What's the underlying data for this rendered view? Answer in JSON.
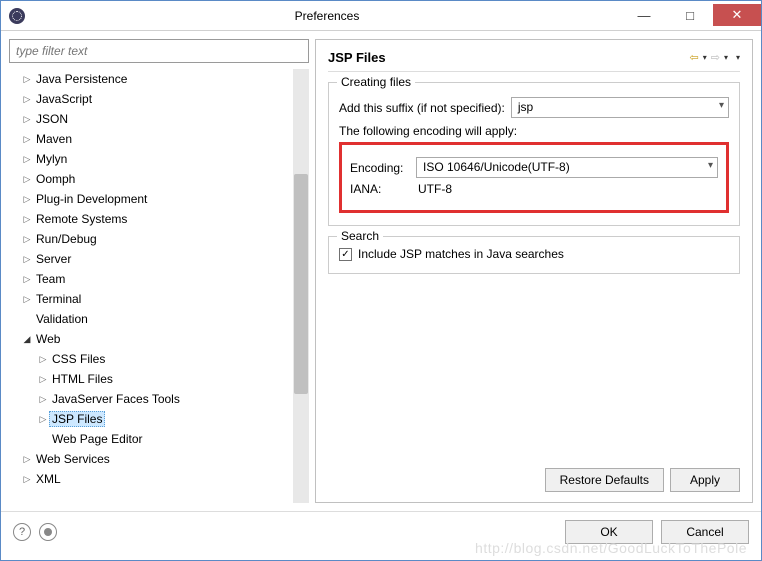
{
  "window": {
    "title": "Preferences"
  },
  "filter": {
    "placeholder": "type filter text"
  },
  "tree": {
    "items": [
      {
        "label": "Java Persistence",
        "level": 1,
        "expand": "▷"
      },
      {
        "label": "JavaScript",
        "level": 1,
        "expand": "▷"
      },
      {
        "label": "JSON",
        "level": 1,
        "expand": "▷"
      },
      {
        "label": "Maven",
        "level": 1,
        "expand": "▷"
      },
      {
        "label": "Mylyn",
        "level": 1,
        "expand": "▷"
      },
      {
        "label": "Oomph",
        "level": 1,
        "expand": "▷"
      },
      {
        "label": "Plug-in Development",
        "level": 1,
        "expand": "▷"
      },
      {
        "label": "Remote Systems",
        "level": 1,
        "expand": "▷"
      },
      {
        "label": "Run/Debug",
        "level": 1,
        "expand": "▷"
      },
      {
        "label": "Server",
        "level": 1,
        "expand": "▷"
      },
      {
        "label": "Team",
        "level": 1,
        "expand": "▷"
      },
      {
        "label": "Terminal",
        "level": 1,
        "expand": "▷"
      },
      {
        "label": "Validation",
        "level": 1,
        "expand": ""
      },
      {
        "label": "Web",
        "level": 1,
        "expand": "◢"
      },
      {
        "label": "CSS Files",
        "level": 2,
        "expand": "▷"
      },
      {
        "label": "HTML Files",
        "level": 2,
        "expand": "▷"
      },
      {
        "label": "JavaServer Faces Tools",
        "level": 2,
        "expand": "▷"
      },
      {
        "label": "JSP Files",
        "level": 2,
        "expand": "▷",
        "selected": true
      },
      {
        "label": "Web Page Editor",
        "level": 2,
        "expand": ""
      },
      {
        "label": "Web Services",
        "level": 1,
        "expand": "▷"
      },
      {
        "label": "XML",
        "level": 1,
        "expand": "▷"
      }
    ]
  },
  "page": {
    "title": "JSP Files",
    "creating": {
      "legend": "Creating files",
      "suffix_label": "Add this suffix (if not specified):",
      "suffix_value": "jsp",
      "encoding_note": "The following encoding will apply:",
      "encoding_label": "Encoding:",
      "encoding_value": "ISO 10646/Unicode(UTF-8)",
      "iana_label": "IANA:",
      "iana_value": "UTF-8"
    },
    "search": {
      "legend": "Search",
      "include_label": "Include JSP matches in Java searches",
      "include_checked": "✓"
    },
    "buttons": {
      "restore": "Restore Defaults",
      "apply": "Apply",
      "ok": "OK",
      "cancel": "Cancel"
    }
  },
  "watermark": "http://blog.csdn.net/GoodLuckToThePole"
}
